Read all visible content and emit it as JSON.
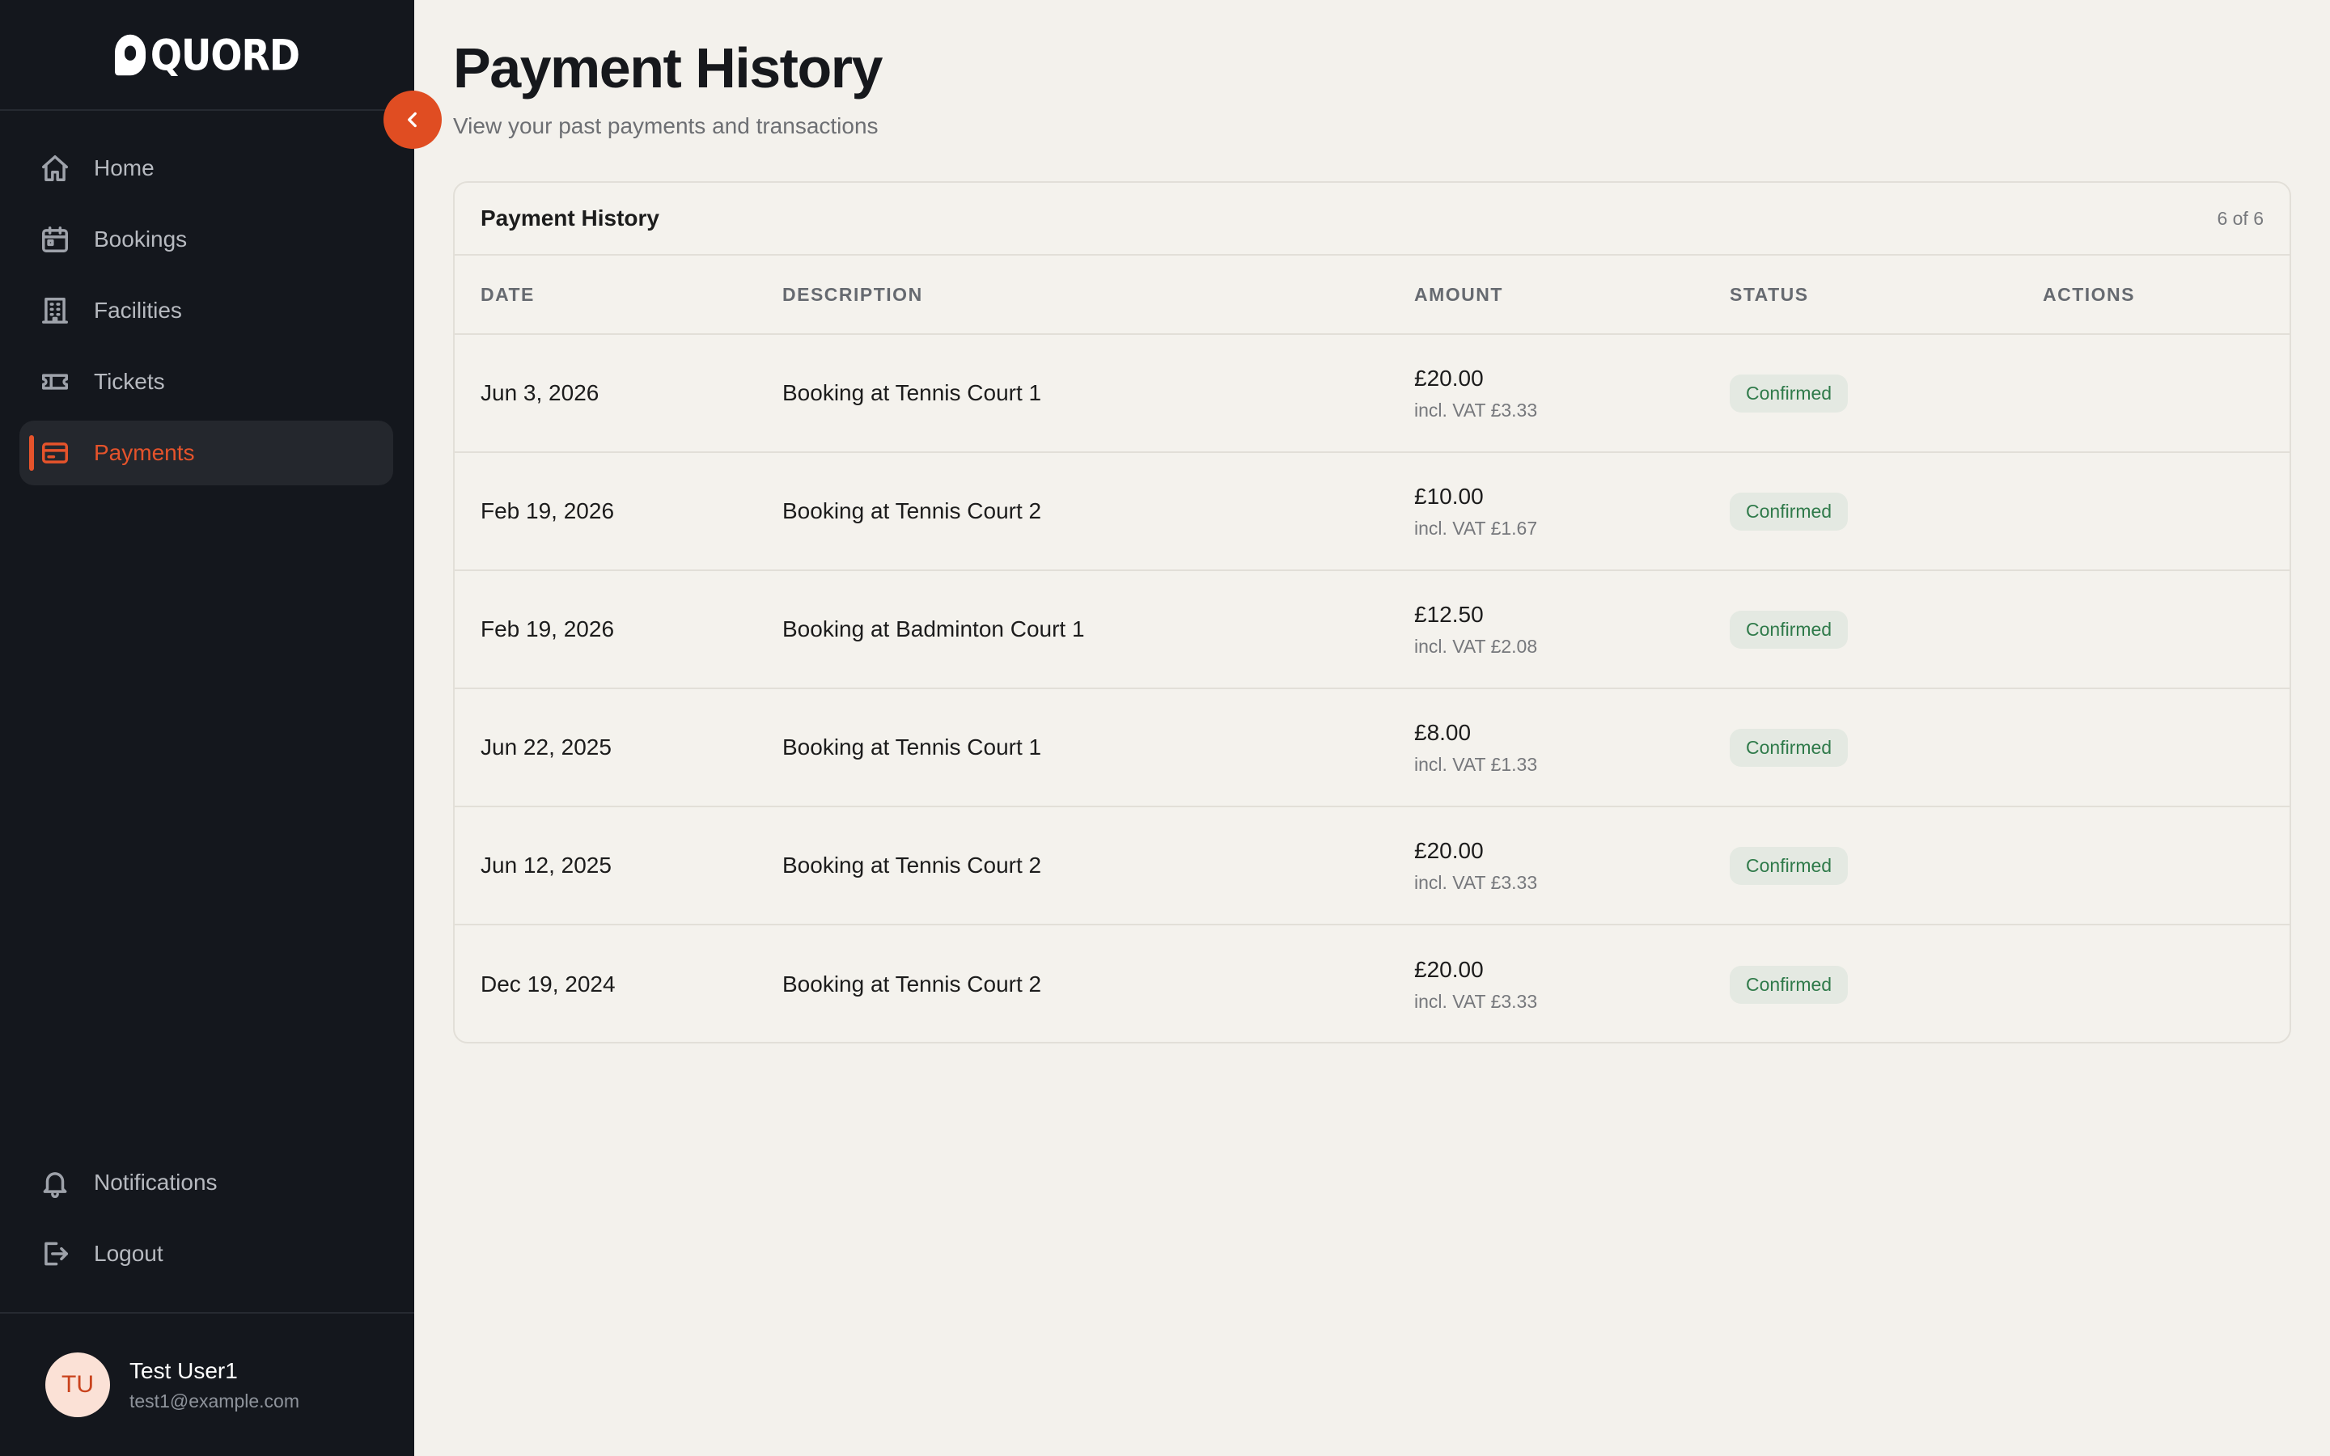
{
  "brand": {
    "name": "QUORD"
  },
  "sidebar": {
    "items": [
      {
        "label": "Home",
        "icon": "home-icon"
      },
      {
        "label": "Bookings",
        "icon": "calendar-icon"
      },
      {
        "label": "Facilities",
        "icon": "building-icon"
      },
      {
        "label": "Tickets",
        "icon": "ticket-icon"
      },
      {
        "label": "Payments",
        "icon": "credit-card-icon",
        "active": true
      }
    ],
    "bottom": [
      {
        "label": "Notifications",
        "icon": "bell-icon"
      },
      {
        "label": "Logout",
        "icon": "logout-icon"
      }
    ],
    "user": {
      "initials": "TU",
      "name": "Test User1",
      "email": "test1@example.com"
    }
  },
  "page": {
    "title": "Payment History",
    "subtitle": "View your past payments and transactions"
  },
  "card": {
    "title": "Payment History",
    "count": "6 of 6",
    "columns": [
      "DATE",
      "DESCRIPTION",
      "AMOUNT",
      "STATUS",
      "ACTIONS"
    ],
    "rows": [
      {
        "date": "Jun 3, 2026",
        "description": "Booking at Tennis Court 1",
        "amount": "£20.00",
        "vat": "incl. VAT £3.33",
        "status": "Confirmed"
      },
      {
        "date": "Feb 19, 2026",
        "description": "Booking at Tennis Court 2",
        "amount": "£10.00",
        "vat": "incl. VAT £1.67",
        "status": "Confirmed"
      },
      {
        "date": "Feb 19, 2026",
        "description": "Booking at Badminton Court 1",
        "amount": "£12.50",
        "vat": "incl. VAT £2.08",
        "status": "Confirmed"
      },
      {
        "date": "Jun 22, 2025",
        "description": "Booking at Tennis Court 1",
        "amount": "£8.00",
        "vat": "incl. VAT £1.33",
        "status": "Confirmed"
      },
      {
        "date": "Jun 12, 2025",
        "description": "Booking at Tennis Court 2",
        "amount": "£20.00",
        "vat": "incl. VAT £3.33",
        "status": "Confirmed"
      },
      {
        "date": "Dec 19, 2024",
        "description": "Booking at Tennis Court 2",
        "amount": "£20.00",
        "vat": "incl. VAT £3.33",
        "status": "Confirmed"
      }
    ]
  },
  "colors": {
    "sidebar_bg": "#14171d",
    "accent": "#e5532b",
    "page_bg": "#f3f1ec",
    "badge_bg": "#e4e9e2",
    "badge_text": "#2f7a4a"
  }
}
